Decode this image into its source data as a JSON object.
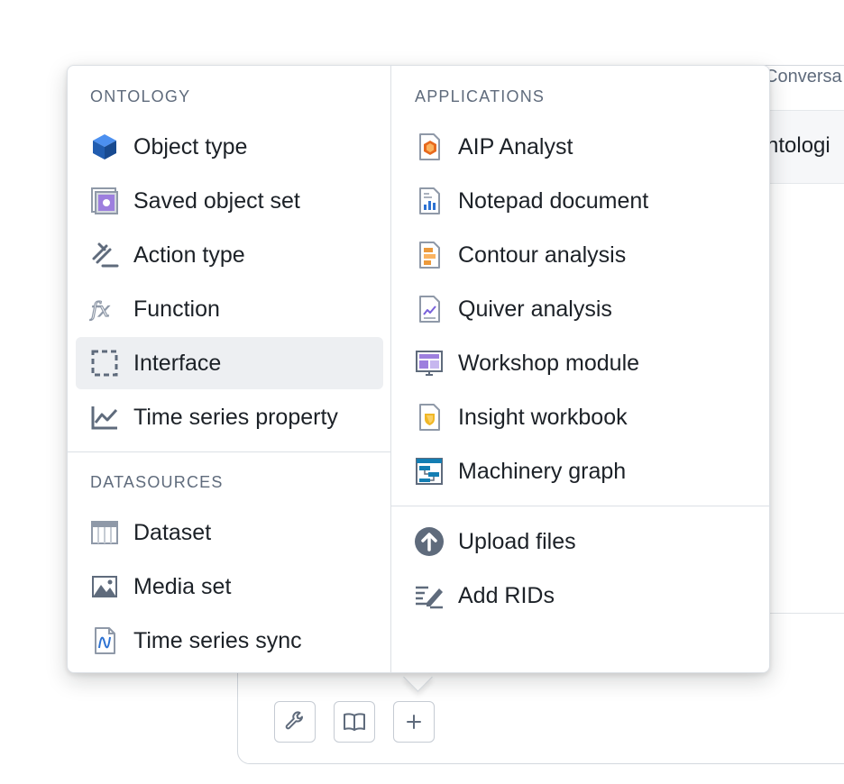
{
  "background": {
    "tab_label": "Conversa",
    "row_text": "ntologi"
  },
  "toolbar": {
    "buttons": [
      {
        "icon": "wrench-icon"
      },
      {
        "icon": "book-icon"
      },
      {
        "icon": "plus-icon"
      }
    ]
  },
  "menu": {
    "ontology": {
      "header": "ONTOLOGY",
      "items": [
        {
          "label": "Object type",
          "icon": "cube-icon"
        },
        {
          "label": "Saved object set",
          "icon": "object-set-icon"
        },
        {
          "label": "Action type",
          "icon": "action-icon"
        },
        {
          "label": "Function",
          "icon": "function-icon"
        },
        {
          "label": "Interface",
          "icon": "interface-icon",
          "active": true
        },
        {
          "label": "Time series property",
          "icon": "timeseries-icon"
        }
      ]
    },
    "datasources": {
      "header": "DATASOURCES",
      "items": [
        {
          "label": "Dataset",
          "icon": "dataset-icon"
        },
        {
          "label": "Media set",
          "icon": "media-icon"
        },
        {
          "label": "Time series sync",
          "icon": "timeseries-sync-icon"
        }
      ]
    },
    "applications": {
      "header": "APPLICATIONS",
      "items": [
        {
          "label": "AIP Analyst",
          "icon": "aip-analyst-icon"
        },
        {
          "label": "Notepad document",
          "icon": "notepad-icon"
        },
        {
          "label": "Contour analysis",
          "icon": "contour-icon"
        },
        {
          "label": "Quiver analysis",
          "icon": "quiver-icon"
        },
        {
          "label": "Workshop module",
          "icon": "workshop-icon"
        },
        {
          "label": "Insight workbook",
          "icon": "insight-icon"
        },
        {
          "label": "Machinery graph",
          "icon": "machinery-icon"
        }
      ]
    },
    "actions": {
      "items": [
        {
          "label": "Upload files",
          "icon": "upload-icon"
        },
        {
          "label": "Add RIDs",
          "icon": "add-rids-icon"
        }
      ]
    }
  },
  "colors": {
    "accent": "#2d72d2",
    "active_bg": "#edeff2",
    "icon_grey": "#5f6b7c"
  }
}
